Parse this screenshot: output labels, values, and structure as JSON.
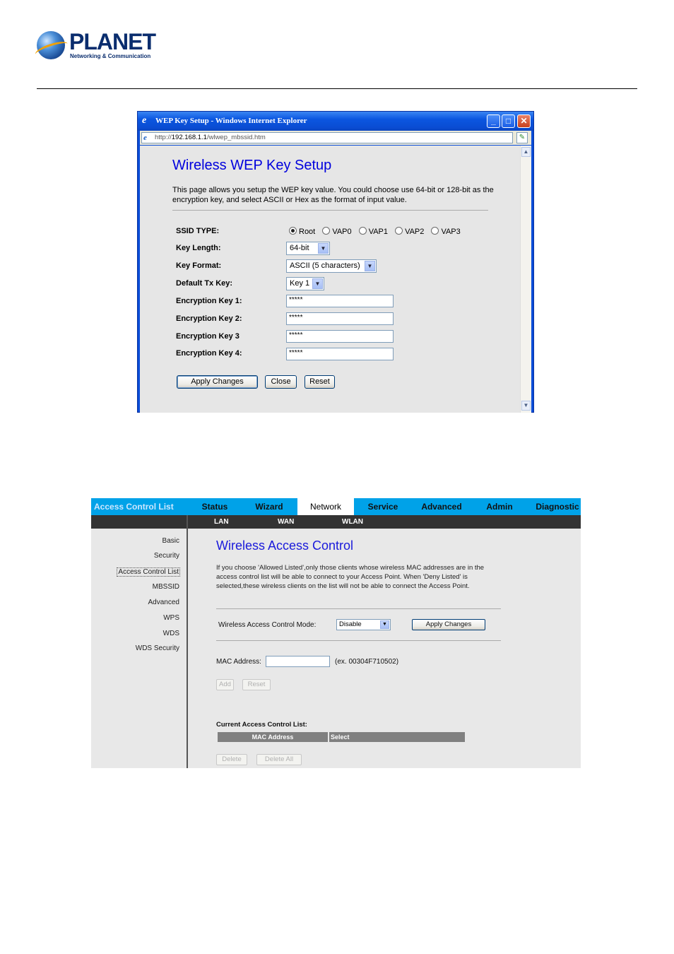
{
  "brand": {
    "name": "PLANET",
    "tagline": "Networking & Communication"
  },
  "ie_window": {
    "title": "WEP Key Setup - Windows Internet Explorer",
    "url_prefix": "http://",
    "url_host": "192.168.1.1",
    "url_path": "/wlwep_mbssid.htm",
    "buttons": {
      "minimize": "_",
      "maximize": "□",
      "close": "✕"
    }
  },
  "wep": {
    "title": "Wireless WEP Key Setup",
    "description": "This page allows you setup the WEP key value. You could choose use 64-bit or 128-bit as the encryption key, and select ASCII or Hex as the format of input value.",
    "ssid_type_label": "SSID TYPE:",
    "ssid_options": [
      "Root",
      "VAP0",
      "VAP1",
      "VAP2",
      "VAP3"
    ],
    "ssid_selected": "Root",
    "key_length_label": "Key Length:",
    "key_length_value": "64-bit",
    "key_format_label": "Key Format:",
    "key_format_value": "ASCII (5 characters)",
    "default_tx_label": "Default Tx Key:",
    "default_tx_value": "Key 1",
    "keys": [
      {
        "label": "Encryption Key 1:",
        "value": "*****"
      },
      {
        "label": "Encryption Key 2:",
        "value": "*****"
      },
      {
        "label": "Encryption Key 3",
        "value": "*****"
      },
      {
        "label": "Encryption Key 4:",
        "value": "*****"
      }
    ],
    "apply_label": "Apply Changes",
    "close_label": "Close",
    "reset_label": "Reset"
  },
  "router": {
    "active_section": "Access Control List",
    "tabs": [
      "Status",
      "Wizard",
      "Network",
      "Service",
      "Advanced",
      "Admin",
      "Diagnostic"
    ],
    "active_tab": "Network",
    "subtabs": [
      "LAN",
      "WAN",
      "WLAN"
    ],
    "sidebar": [
      "Basic",
      "Security",
      "Access Control List",
      "MBSSID",
      "Advanced",
      "WPS",
      "WDS",
      "WDS Security"
    ],
    "title": "Wireless Access Control",
    "description": "If you choose 'Allowed Listed',only those clients whose wireless MAC addresses are in the access control list will be able to connect to your Access Point. When 'Deny Listed' is selected,these wireless clients on the list will not be able to connect the Access Point.",
    "mode_label": "Wireless Access Control Mode:",
    "mode_value": "Disable",
    "apply_label": "Apply Changes",
    "mac_label": "MAC Address:",
    "mac_value": "",
    "mac_example": "(ex. 00304F710502)",
    "add_label": "Add",
    "reset_label": "Reset",
    "list_title": "Current Access Control List:",
    "columns": [
      "MAC Address",
      "Select"
    ],
    "delete_label": "Delete",
    "delete_all_label": "Delete All"
  }
}
